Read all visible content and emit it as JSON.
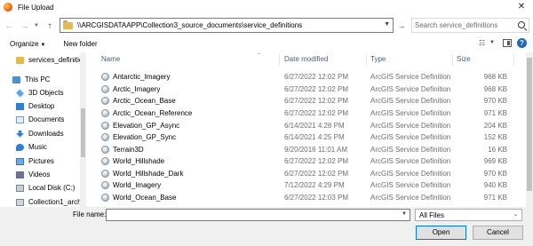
{
  "window": {
    "title": "File Upload",
    "close_glyph": "✕"
  },
  "address": {
    "back_glyph": "←",
    "forward_glyph": "→",
    "up_glyph": "↑",
    "path": "\\\\ARCGISDATAAPP\\Collection3_source_documents\\service_definitions",
    "go_glyph": "→",
    "search_placeholder": "Search service_definitions"
  },
  "toolbar": {
    "organize": "Organize",
    "new_folder": "New folder",
    "help_glyph": "?"
  },
  "sidebar": {
    "items": [
      {
        "label": "services_definitions",
        "icon": "folder-icon"
      },
      {
        "label": "This PC",
        "icon": "pc-icon"
      },
      {
        "label": "3D Objects",
        "icon": "3d-objects-icon"
      },
      {
        "label": "Desktop",
        "icon": "desktop-icon"
      },
      {
        "label": "Documents",
        "icon": "documents-icon"
      },
      {
        "label": "Downloads",
        "icon": "downloads-icon"
      },
      {
        "label": "Music",
        "icon": "music-icon"
      },
      {
        "label": "Pictures",
        "icon": "pictures-icon"
      },
      {
        "label": "Videos",
        "icon": "videos-icon"
      },
      {
        "label": "Local Disk (C:)",
        "icon": "disk-icon"
      },
      {
        "label": "Collection1_arch",
        "icon": "network-drive-icon"
      }
    ]
  },
  "columns": {
    "name": "Name",
    "date": "Date modified",
    "type": "Type",
    "size": "Size"
  },
  "files": [
    {
      "name": "Antarctic_Imagery",
      "date": "6/27/2022 12:02 PM",
      "type": "ArcGIS Service Definition",
      "size": "968 KB"
    },
    {
      "name": "Arctic_Imagery",
      "date": "6/27/2022 12:02 PM",
      "type": "ArcGIS Service Definition",
      "size": "968 KB"
    },
    {
      "name": "Arctic_Ocean_Base",
      "date": "6/27/2022 12:02 PM",
      "type": "ArcGIS Service Definition",
      "size": "970 KB"
    },
    {
      "name": "Arctic_Ocean_Reference",
      "date": "6/27/2022 12:02 PM",
      "type": "ArcGIS Service Definition",
      "size": "971 KB"
    },
    {
      "name": "Elevation_GP_Async",
      "date": "6/14/2021 4:28 PM",
      "type": "ArcGIS Service Definition",
      "size": "204 KB"
    },
    {
      "name": "Elevation_GP_Sync",
      "date": "6/14/2021 4:25 PM",
      "type": "ArcGIS Service Definition",
      "size": "152 KB"
    },
    {
      "name": "Terrain3D",
      "date": "9/20/2016 11:01 AM",
      "type": "ArcGIS Service Definition",
      "size": "16 KB"
    },
    {
      "name": "World_Hillshade",
      "date": "6/27/2022 12:02 PM",
      "type": "ArcGIS Service Definition",
      "size": "969 KB"
    },
    {
      "name": "World_Hillshade_Dark",
      "date": "6/27/2022 12:02 PM",
      "type": "ArcGIS Service Definition",
      "size": "970 KB"
    },
    {
      "name": "World_Imagery",
      "date": "7/12/2022 4:29 PM",
      "type": "ArcGIS Service Definition",
      "size": "940 KB"
    },
    {
      "name": "World_Ocean_Base",
      "date": "6/27/2022 12:03 PM",
      "type": "ArcGIS Service Definition",
      "size": "971 KB"
    }
  ],
  "footer": {
    "file_name_label": "File name:",
    "file_name_value": "",
    "filter": "All Files",
    "open": "Open",
    "cancel": "Cancel"
  }
}
